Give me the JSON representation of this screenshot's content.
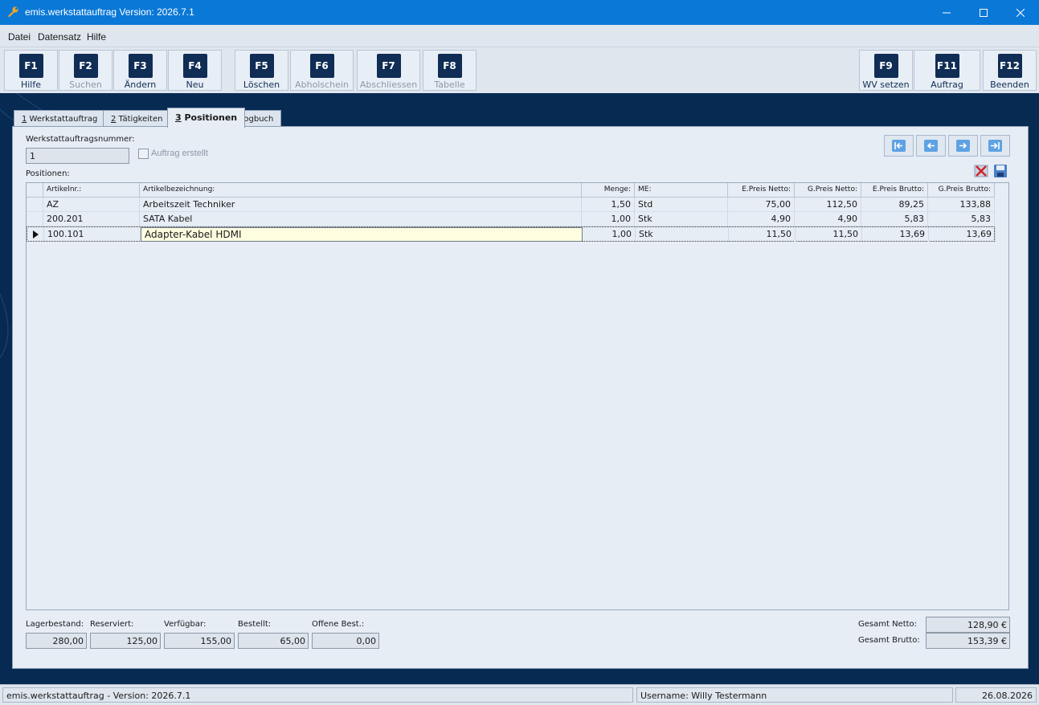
{
  "window": {
    "title": "emis.werkstattauftrag Version: 2026.7.1"
  },
  "menu": [
    "Datei",
    "Datensatz",
    "Hilfe"
  ],
  "toolbar": [
    {
      "key": "F1",
      "label": "Hilfe",
      "enabled": true
    },
    {
      "key": "F2",
      "label": "Suchen",
      "enabled": false
    },
    {
      "key": "F3",
      "label": "Ändern",
      "enabled": true
    },
    {
      "key": "F4",
      "label": "Neu",
      "enabled": true
    },
    {
      "key": "F5",
      "label": "Löschen",
      "enabled": true
    },
    {
      "key": "F6",
      "label": "Abholschein",
      "enabled": false
    },
    {
      "key": "F7",
      "label": "Abschliessen",
      "enabled": false
    },
    {
      "key": "F8",
      "label": "Tabelle",
      "enabled": false
    },
    {
      "key": "F9",
      "label": "WV setzen",
      "enabled": true
    },
    {
      "key": "F11",
      "label": "Auftrag",
      "enabled": true
    },
    {
      "key": "F12",
      "label": "Beenden",
      "enabled": true
    }
  ],
  "tabs": [
    {
      "num": "1",
      "label": " Werkstattauftrag"
    },
    {
      "num": "2",
      "label": " Tätigkeiten"
    },
    {
      "num": "3",
      "label": " Positionen",
      "active": true
    },
    {
      "num": "",
      "label": "Logbuch"
    }
  ],
  "form": {
    "order_number_label": "Werkstattauftragsnummer:",
    "order_number": "1",
    "order_created_label": "Auftrag erstellt",
    "order_created": false,
    "positions_label": "Positionen:"
  },
  "grid": {
    "headers": [
      "Artikelnr.:",
      "Artikelbezeichnung:",
      "Menge:",
      "ME:",
      "E.Preis Netto:",
      "G.Preis Netto:",
      "E.Preis Brutto:",
      "G.Preis Brutto:"
    ],
    "rows": [
      {
        "nr": "AZ",
        "bez": "Arbeitszeit Techniker",
        "menge": "1,50",
        "me": "Std",
        "ep_netto": "75,00",
        "gp_netto": "112,50",
        "ep_brutto": "89,25",
        "gp_brutto": "133,88"
      },
      {
        "nr": "200.201",
        "bez": "SATA Kabel",
        "menge": "1,00",
        "me": "Stk",
        "ep_netto": "4,90",
        "gp_netto": "4,90",
        "ep_brutto": "5,83",
        "gp_brutto": "5,83"
      },
      {
        "nr": "100.101",
        "bez": "Adapter-Kabel HDMI",
        "menge": "1,00",
        "me": "Stk",
        "ep_netto": "11,50",
        "gp_netto": "11,50",
        "ep_brutto": "13,69",
        "gp_brutto": "13,69"
      }
    ]
  },
  "stock": {
    "lagerbestand_label": "Lagerbestand:",
    "lagerbestand": "280,00",
    "reserviert_label": "Reserviert:",
    "reserviert": "125,00",
    "verfuegbar_label": "Verfügbar:",
    "verfuegbar": "155,00",
    "bestellt_label": "Bestellt:",
    "bestellt": "65,00",
    "offene_label": "Offene Best.:",
    "offene": "0,00"
  },
  "totals": {
    "netto_label": "Gesamt Netto:",
    "netto": "128,90 €",
    "brutto_label": "Gesamt Brutto:",
    "brutto": "153,39 €"
  },
  "status": {
    "app": "emis.werkstattauftrag - Version: 2026.7.1",
    "user": "Username: Willy Testermann",
    "date": "26.08.2026"
  },
  "colors": {
    "titlebar": "#0a78d7",
    "stage": "#072a52",
    "key_bg": "#102d55",
    "selected_cell": "#fffde0"
  }
}
